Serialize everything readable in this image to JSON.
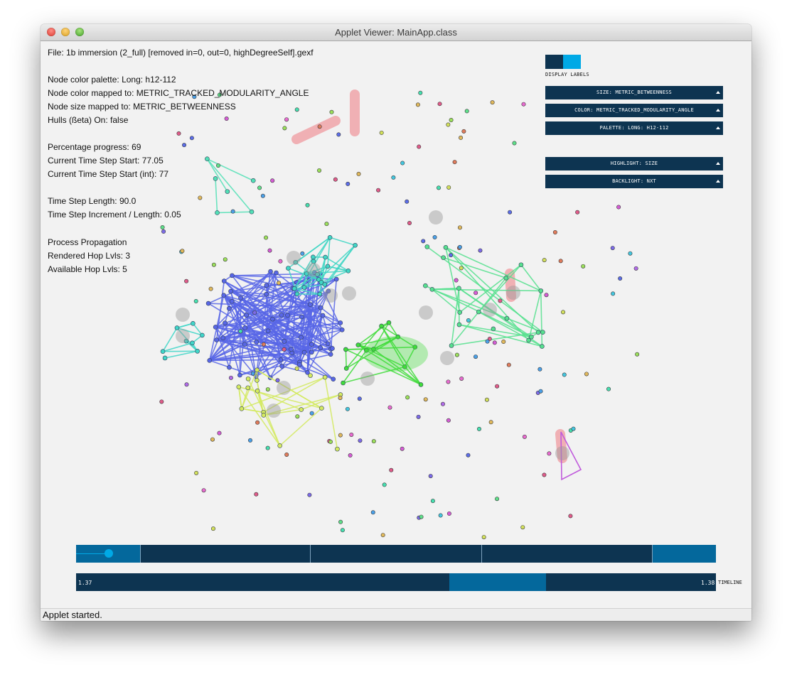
{
  "window": {
    "title": "Applet Viewer: MainApp.class"
  },
  "info": {
    "file": "File: 1b immersion (2_full) [removed in=0, out=0, highDegreeSelf].gexf",
    "palette": "Node color palette: Long: h12-112",
    "color_mapped": "Node color mapped to: METRIC_TRACKED_MODULARITY_ANGLE",
    "size_mapped": "Node size mapped to: METRIC_BETWEENNESS",
    "hulls": "Hulls (ßeta) On: false",
    "progress": "Percentage progress: 69",
    "step_start": "Current Time Step Start: 77.05",
    "step_start_int": "Current Time Step Start (int): 77",
    "step_length": "Time Step Length: 90.0",
    "step_increment": "Time Step Increment / Length: 0.05",
    "process": "Process Propagation",
    "rendered_hops": "Rendered Hop Lvls: 3",
    "available_hops": "Available Hop Lvls: 5"
  },
  "controls": {
    "display_labels": "DISPLAY LABELS",
    "toggle_colors": {
      "off": "#0d3451",
      "on": "#00a9e6"
    },
    "dropdowns": [
      "SIZE: METRIC_BETWEENNESS",
      "COLOR: METRIC_TRACKED_MODULARITY_ANGLE",
      "PALETTE: LONG: H12-112",
      "HIGHLIGHT: SIZE",
      "BACKLIGHT: NXT"
    ]
  },
  "timeline": {
    "start_label": "1.37",
    "end_label": "1.38",
    "label": "TIMELINE",
    "progress": 0.69
  },
  "status": "Applet started.",
  "colors": {
    "window_bg": "#f2f2f2",
    "control_dark": "#0d3451",
    "control_mid": "#04689c",
    "control_light": "#00a9e6"
  }
}
